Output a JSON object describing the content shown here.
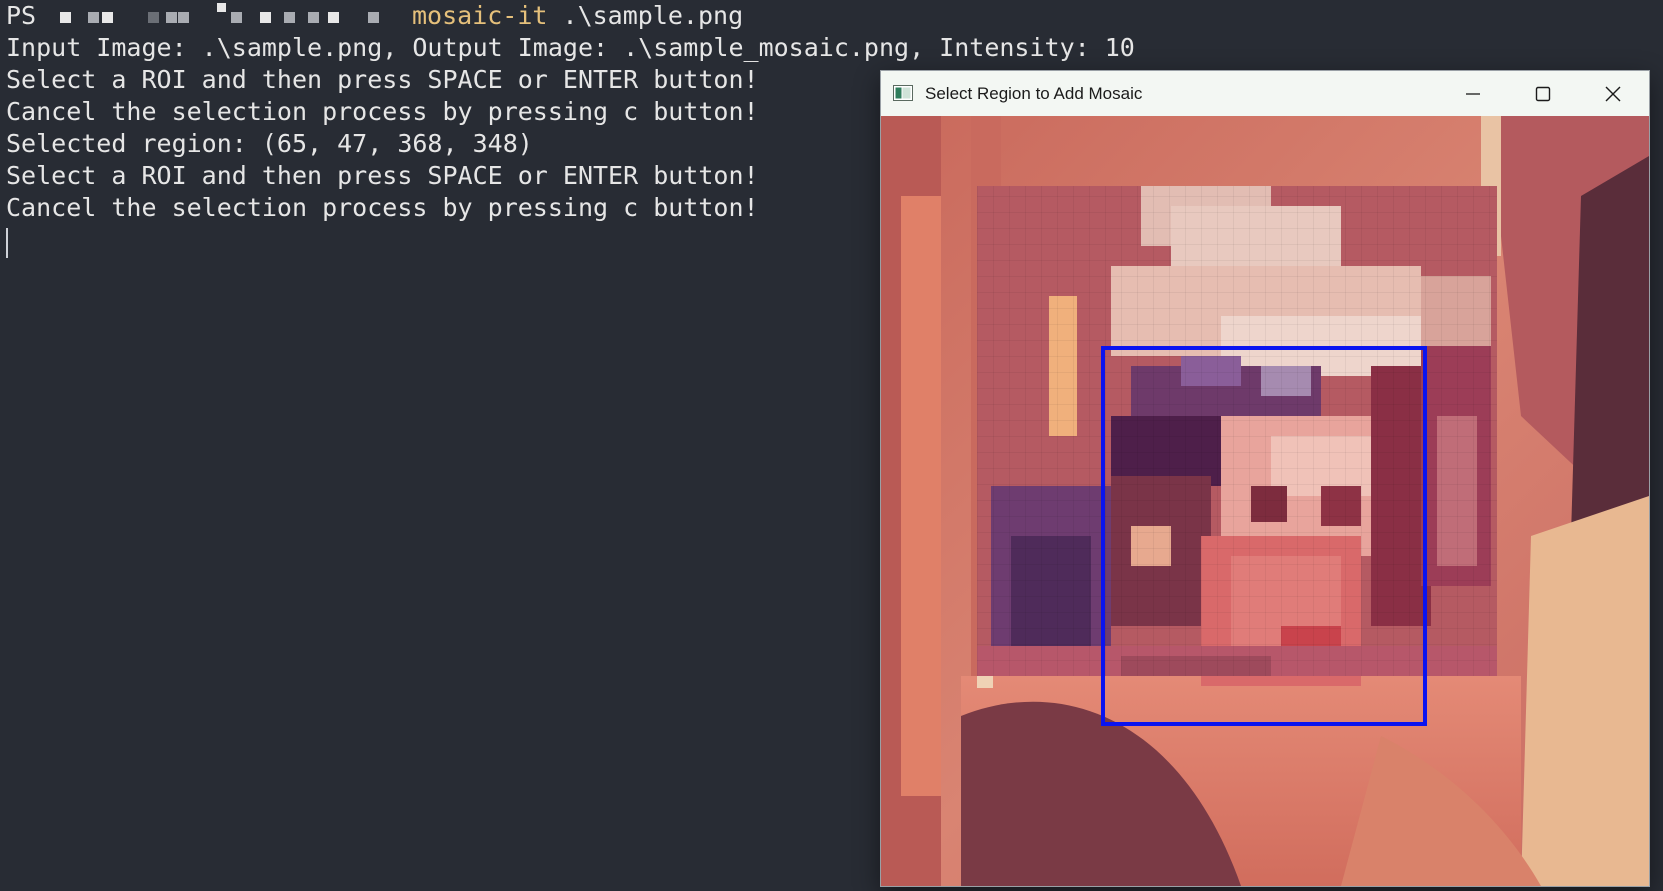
{
  "terminal": {
    "prompt_prefix": "PS",
    "command_name": "mosaic-it",
    "command_args": " .\\sample.png",
    "output_lines": [
      "Input Image: .\\sample.png, Output Image: .\\sample_mosaic.png, Intensity: 10",
      "Select a ROI and then press SPACE or ENTER button!",
      "Cancel the selection process by pressing c button!",
      "Selected region: (65, 47, 368, 348)",
      "Select a ROI and then press SPACE or ENTER button!",
      "Cancel the selection process by pressing c button!"
    ],
    "colors": {
      "background": "#282c34",
      "text": "#e6e6e6",
      "command": "#e5c07b"
    }
  },
  "window": {
    "title": "Select Region to Add Mosaic",
    "icons": {
      "app": "app-window-icon",
      "minimize": "minimize-icon",
      "maximize": "maximize-icon",
      "close": "close-icon"
    },
    "roi_color": "#0a14f0"
  }
}
